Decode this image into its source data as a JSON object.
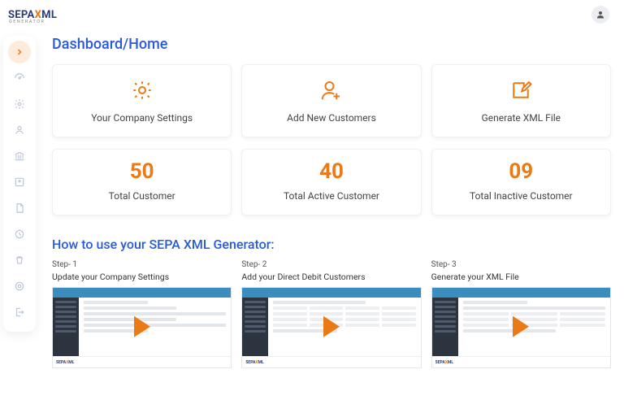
{
  "brand": {
    "text1": "SEPA",
    "x": "X",
    "text2": "ML",
    "sub": "GENERATOR"
  },
  "page": {
    "title": "Dashboard/Home"
  },
  "actions": [
    {
      "label": "Your Company Settings"
    },
    {
      "label": "Add New Customers"
    },
    {
      "label": "Generate XML File"
    }
  ],
  "stats": [
    {
      "value": "50",
      "label": "Total Customer"
    },
    {
      "value": "40",
      "label": "Total Active Customer"
    },
    {
      "value": "09",
      "label": "Total Inactive Customer"
    }
  ],
  "howto": {
    "title": "How to use your SEPA XML Generator:",
    "steps": [
      {
        "num": "Step- 1",
        "label": "Update your Company Settings"
      },
      {
        "num": "Step- 2",
        "label": "Add your Direct Debit Customers"
      },
      {
        "num": "Step- 3",
        "label": "Generate your XML File"
      }
    ],
    "mini_logo": {
      "t1": "SEPA",
      "x": "X",
      "t2": "ML"
    }
  }
}
